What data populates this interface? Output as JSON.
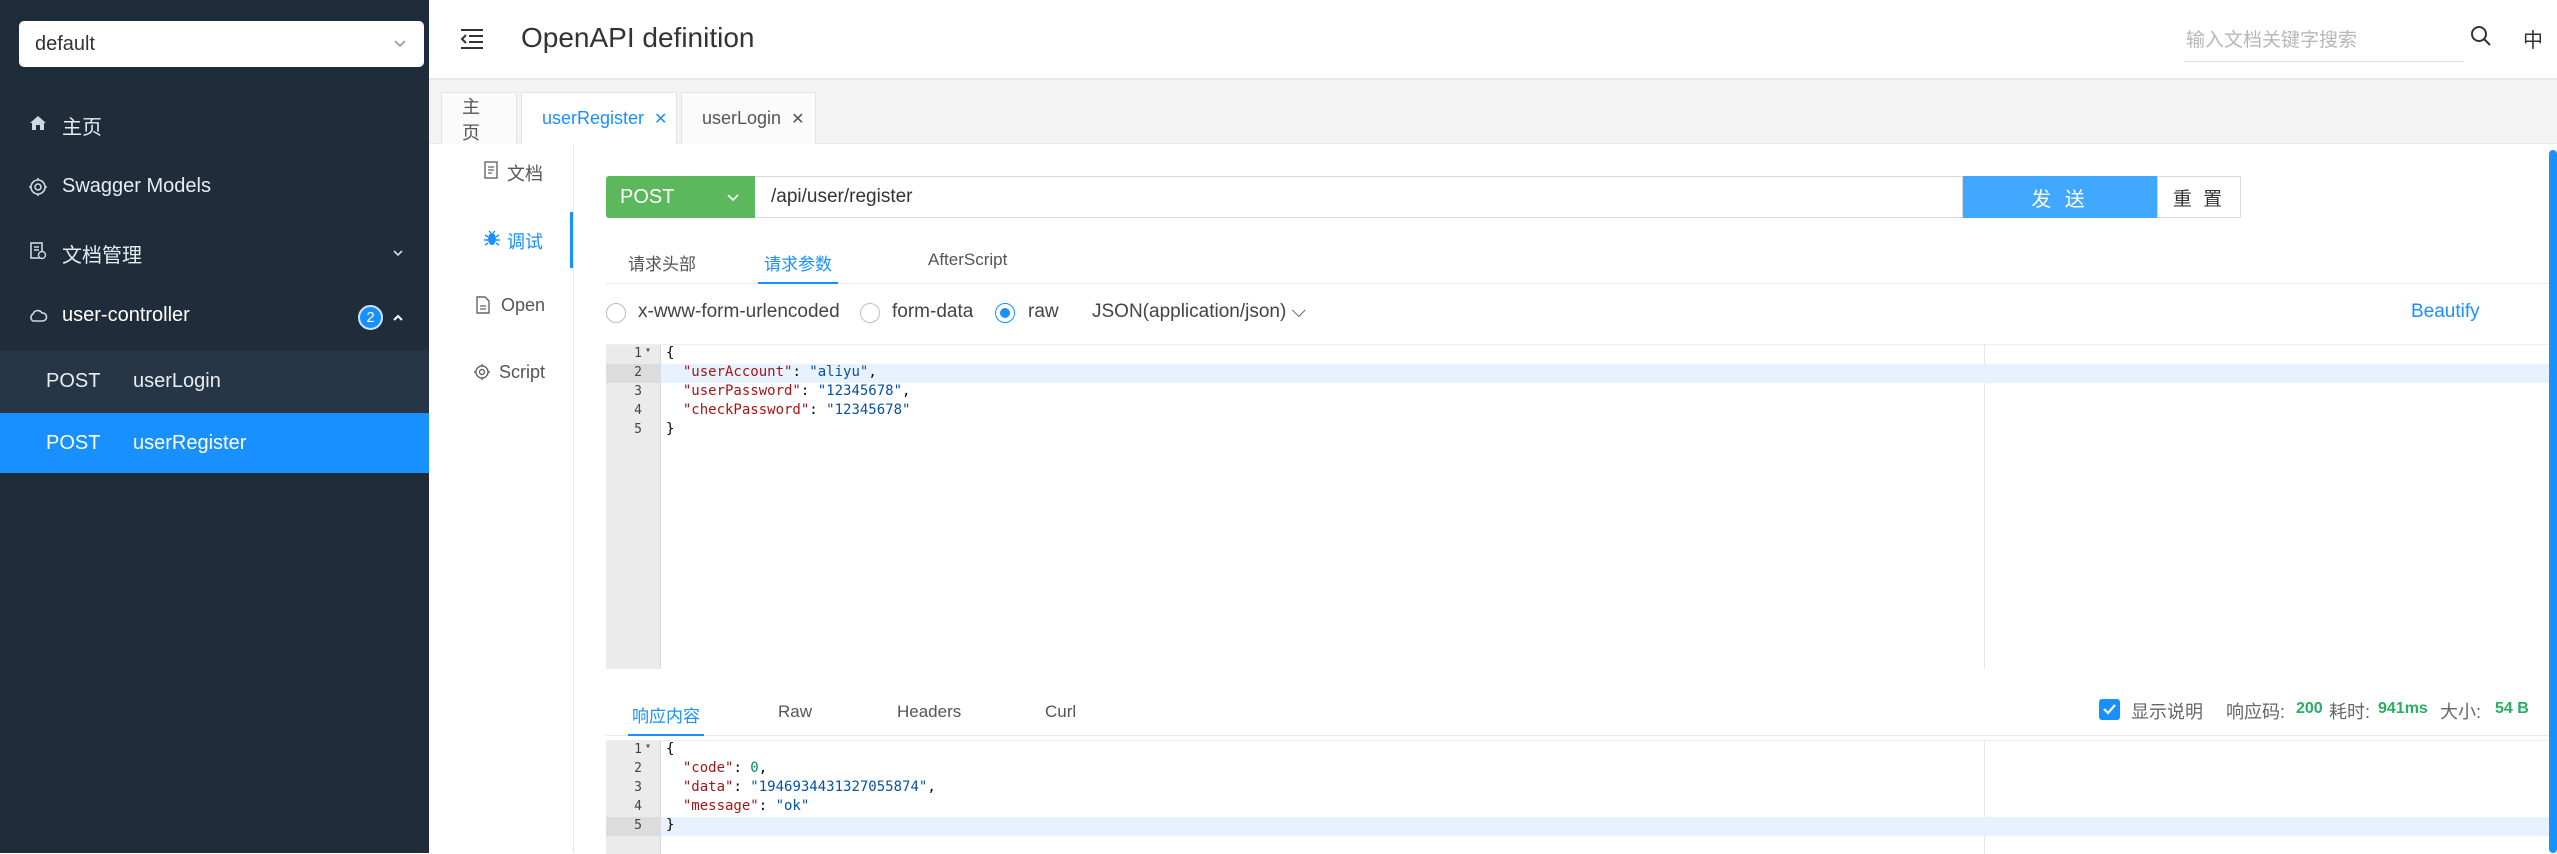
{
  "sidebar": {
    "group_select": "default",
    "items": [
      {
        "label": "主页",
        "icon": "home-icon"
      },
      {
        "label": "Swagger Models",
        "icon": "settings-icon"
      },
      {
        "label": "文档管理",
        "icon": "doc-manage-icon"
      },
      {
        "label": "user-controller",
        "icon": "cloud-icon",
        "badge": "2"
      }
    ],
    "endpoints": [
      {
        "method": "POST",
        "name": "userLogin"
      },
      {
        "method": "POST",
        "name": "userRegister"
      }
    ]
  },
  "header": {
    "title": "OpenAPI definition",
    "search_placeholder": "输入文档关键字搜索",
    "lang": "中"
  },
  "tabs": [
    {
      "label": "主页"
    },
    {
      "label": "userRegister"
    },
    {
      "label": "userLogin"
    }
  ],
  "vtabs": [
    {
      "label": "文档",
      "icon": "document-icon"
    },
    {
      "label": "调试",
      "icon": "bug-icon"
    },
    {
      "label": "Open",
      "icon": "file-icon"
    },
    {
      "label": "Script",
      "icon": "script-icon"
    }
  ],
  "request": {
    "method": "POST",
    "url": "/api/user/register",
    "send_label": "发 送",
    "reset_label": "重 置",
    "subtabs": [
      "请求头部",
      "请求参数",
      "AfterScript"
    ],
    "body_types": [
      "x-www-form-urlencoded",
      "form-data",
      "raw"
    ],
    "selected_body_type": "raw",
    "content_type": "JSON(application/json)",
    "beautify_label": "Beautify",
    "body_lines": [
      "1",
      "2",
      "3",
      "4",
      "5"
    ]
  },
  "response": {
    "tabs": [
      "响应内容",
      "Raw",
      "Headers",
      "Curl"
    ],
    "show_desc_label": "显示说明",
    "status_code_label": "响应码:",
    "status_code": "200",
    "time_label": "耗时:",
    "time": "941ms",
    "size_label": "大小:",
    "size": "54 B",
    "body_lines": [
      "1",
      "2",
      "3",
      "4",
      "5"
    ]
  },
  "colors": {
    "sidebar_bg": "#1f2d3b",
    "accent": "#1890ff",
    "post_green": "#5cb85c",
    "send_blue": "#40a9ff",
    "status_green": "#27ae60"
  }
}
